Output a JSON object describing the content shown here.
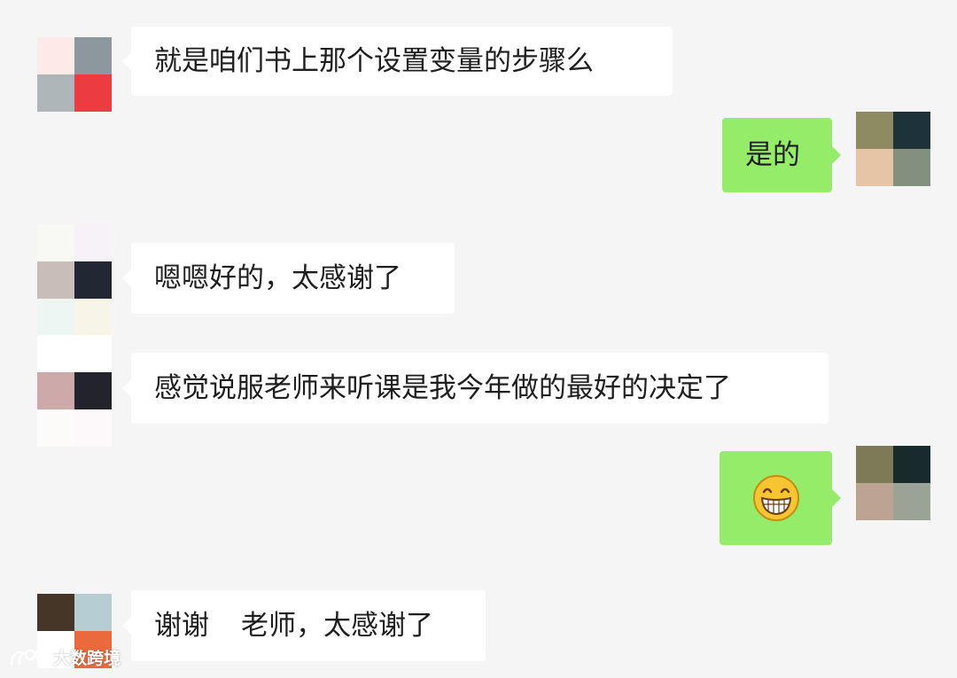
{
  "messages": [
    {
      "side": "in",
      "text": "就是咱们书上那个设置变量的步骤么"
    },
    {
      "side": "out",
      "text": "是的"
    },
    {
      "side": "in",
      "text": "嗯嗯好的，太感谢了"
    },
    {
      "side": "in",
      "text": "感觉说服老师来听课是我今年做的最好的决定了"
    },
    {
      "side": "out",
      "emoji": "grinning-emoji"
    },
    {
      "side": "in",
      "text_before_gap": "谢谢",
      "text_after_gap": "老师，太感谢了"
    }
  ],
  "avatars": {
    "a1": [
      "#fde9e7",
      "#8c989e",
      "#aeb6ba",
      "#ec3b41"
    ],
    "self1": [
      "#8e8a62",
      "#1e3339",
      "#e6c4a6",
      "#84907f"
    ],
    "a2": [
      "#f8f8f4",
      "#f6f2f8",
      "#c8bdb8",
      "#222733",
      "#eef6f4",
      "#f6f5e8"
    ],
    "a3": [
      "#ffffff",
      "#ffffff",
      "#cea9a9",
      "#23232b",
      "#fdfafa",
      "#fdf9fa"
    ],
    "self2": [
      "#7e7a58",
      "#192a2c",
      "#bda391",
      "#9aa396"
    ],
    "a4": [
      "#463628",
      "#b5cdd3",
      "#ffffff",
      "#ea6a3d"
    ]
  },
  "watermark": {
    "text": "大数跨境",
    "logo": "bird-logo-icon"
  },
  "colors": {
    "background": "#f5f5f5",
    "incoming_bubble": "#ffffff",
    "outgoing_bubble": "#95ec69"
  }
}
